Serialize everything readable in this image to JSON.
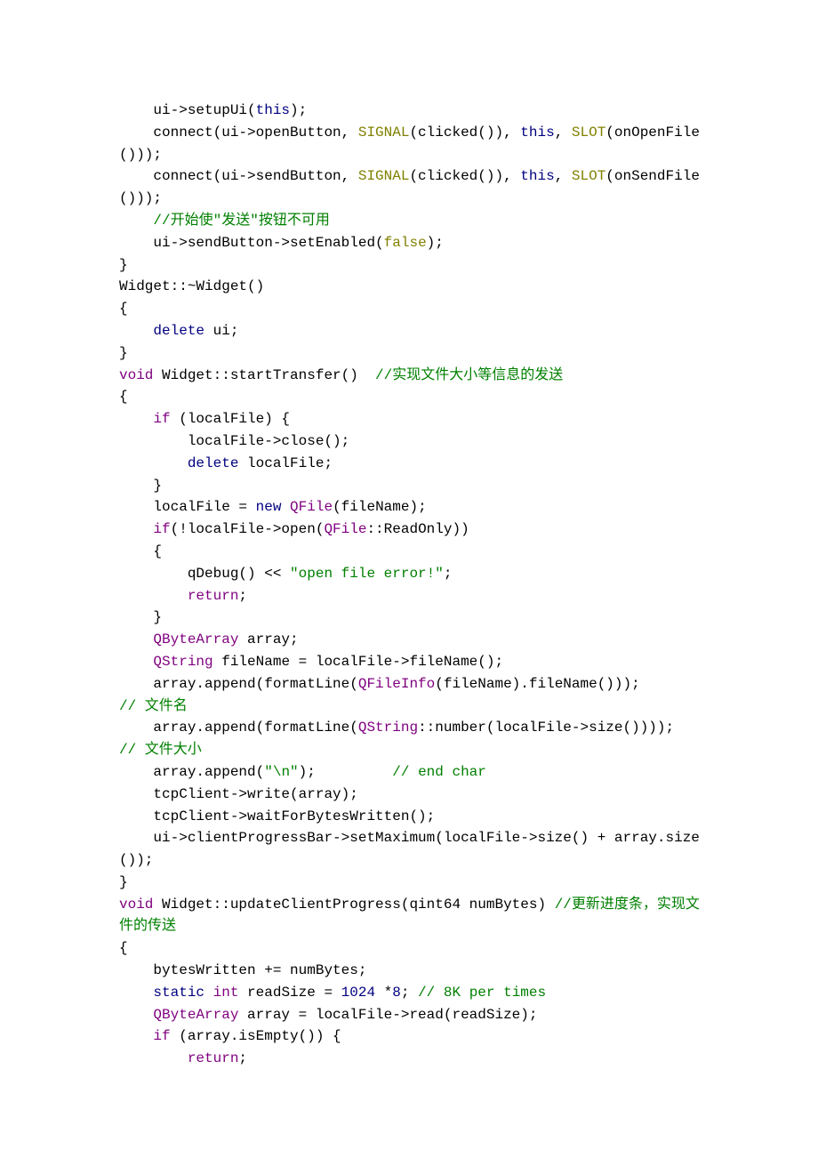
{
  "code_lines": [
    "    ui->setupUi(<KW2>this</KW2>);",
    "    connect(ui->openButton, <MC>SIGNAL</MC>(clicked()), <KW2>this</KW2>, <MC>SLOT</MC>(onOpenFile()));",
    "    connect(ui->sendButton, <MC>SIGNAL</MC>(clicked()), <KW2>this</KW2>, <MC>SLOT</MC>(onSendFile()));",
    "    <CM>//开始使\"发送\"按钮不可用</CM>",
    "    ui->sendButton->setEnabled(<LIT>false</LIT>);",
    "}",
    "Widget::~Widget()",
    "{",
    "    <KW2>delete</KW2> ui;",
    "}",
    "<KW>void</KW> Widget::startTransfer()  <CM>//实现文件大小等信息的发送</CM>",
    "{",
    "    <KW>if</KW> (localFile) {",
    "        localFile->close();",
    "        <KW2>delete</KW2> localFile;",
    "    }",
    "    localFile = <KW2>new</KW2> <TY>QFile</TY>(fileName);",
    "    <KW>if</KW>(!localFile->open(<TY>QFile</TY>::ReadOnly))",
    "    {",
    "        qDebug() << <STR>\"open file error!\"</STR>;",
    "        <KW>return</KW>;",
    "    }",
    "    <TY>QByteArray</TY> array;",
    "    <TY>QString</TY> fileName = localFile->fileName();",
    "    array.append(formatLine(<TY>QFileInfo</TY>(fileName).fileName()));        <CM>// 文件名</CM>",
    "    array.append(formatLine(<TY>QString</TY>::number(localFile->size())));   <CM>// 文件大小</CM>",
    "    array.append(<STR>\"\\n\"</STR>);         <CM>// end char</CM>",
    "    tcpClient->write(array);",
    "    tcpClient->waitForBytesWritten();",
    "    ui->clientProgressBar->setMaximum(localFile->size() + array.size());",
    "}",
    "<KW>void</KW> Widget::updateClientProgress(qint64 numBytes) <CM>//更新进度条，实现文件的传送</CM>",
    "{",
    "    bytesWritten += numBytes;",
    "    <KW2>static</KW2> <KW>int</KW> readSize = <NUM>1024</NUM> *<NUM>8</NUM>; <CM>// 8K per times</CM>",
    "    <TY>QByteArray</TY> array = localFile->read(readSize);",
    "    <KW>if</KW> (array.isEmpty()) {",
    "        <KW>return</KW>;"
  ]
}
